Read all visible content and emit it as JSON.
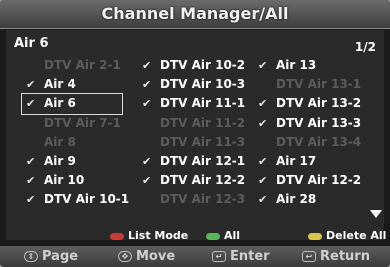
{
  "title": "Channel Manager/All",
  "current_channel": "Air 6",
  "page_indicator": "1/2",
  "columns": [
    [
      {
        "label": "DTV Air 2-1",
        "checked": false
      },
      {
        "label": "Air 4",
        "checked": true
      },
      {
        "label": "Air 6",
        "checked": true,
        "selected": true
      },
      {
        "label": "DTV Air 7-1",
        "checked": false
      },
      {
        "label": "Air 8",
        "checked": false
      },
      {
        "label": "Air 9",
        "checked": true
      },
      {
        "label": "Air 10",
        "checked": true
      },
      {
        "label": "DTV Air 10-1",
        "checked": true
      }
    ],
    [
      {
        "label": "DTV Air 10-2",
        "checked": true
      },
      {
        "label": "DTV Air 10-3",
        "checked": true
      },
      {
        "label": "DTV Air 11-1",
        "checked": true
      },
      {
        "label": "DTV Air 11-2",
        "checked": false
      },
      {
        "label": "DTV Air 11-3",
        "checked": false
      },
      {
        "label": "DTV Air 12-1",
        "checked": true
      },
      {
        "label": "DTV Air 12-2",
        "checked": true
      },
      {
        "label": "DTV Air 12-3",
        "checked": false
      }
    ],
    [
      {
        "label": "Air 13",
        "checked": true
      },
      {
        "label": "DTV Air 13-1",
        "checked": false
      },
      {
        "label": "DTV Air 13-2",
        "checked": true
      },
      {
        "label": "DTV Air 13-3",
        "checked": true
      },
      {
        "label": "DTV Air 13-4",
        "checked": false
      },
      {
        "label": "Air 17",
        "checked": true
      },
      {
        "label": "DTV Air 12-2",
        "checked": true
      },
      {
        "label": "Air 28",
        "checked": true
      }
    ]
  ],
  "legend": {
    "list_mode": "List Mode",
    "all": "All",
    "delete_all": "Delete All"
  },
  "bottom_bar": {
    "page": "Page",
    "move": "Move",
    "enter": "Enter",
    "return": "Return"
  },
  "colors": {
    "red_button": "#c93b3b",
    "green_button": "#58b458",
    "yellow_button": "#d9c448"
  }
}
